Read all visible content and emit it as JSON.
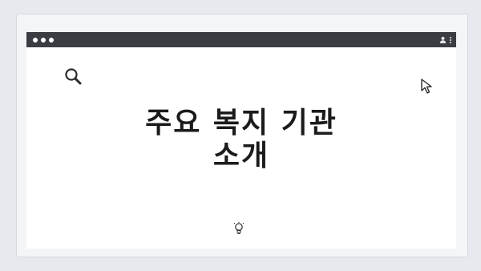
{
  "slide": {
    "title_line1": "주요 복지 기관",
    "title_line2": "소개"
  },
  "icons": {
    "search": "search-icon",
    "cursor": "cursor-icon",
    "lightbulb": "lightbulb-icon",
    "user": "user-icon",
    "menu": "kebab-menu-icon"
  },
  "colors": {
    "titlebar": "#3a3d42",
    "background": "#e6e9ee",
    "text": "#1b1b1b"
  }
}
